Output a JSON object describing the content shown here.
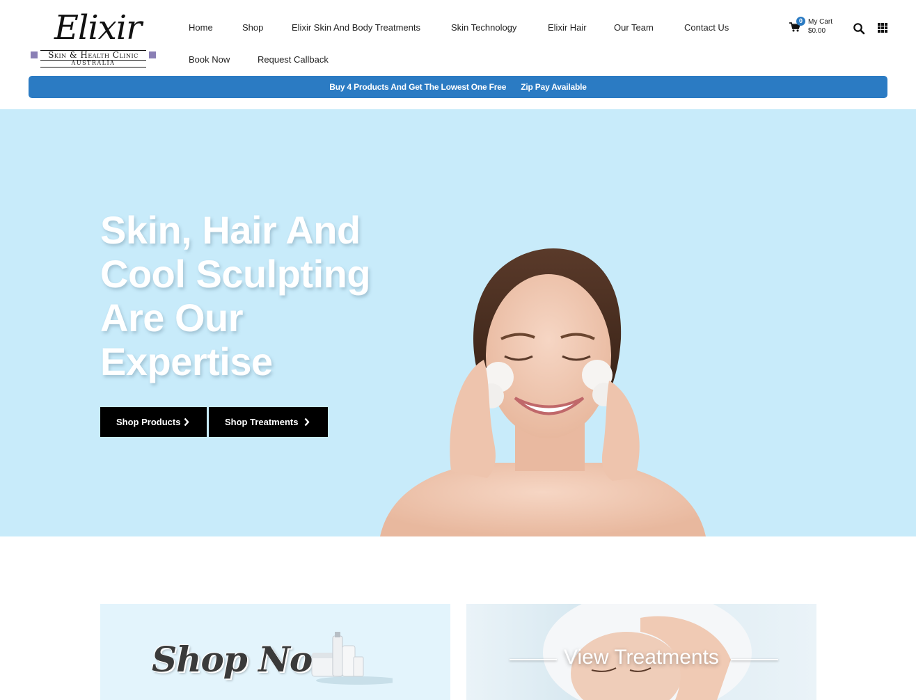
{
  "brand": {
    "logo_script": "Elixir",
    "logo_line1": "Skin & Health Clinic",
    "logo_line2": "AUSTRALIA"
  },
  "nav": {
    "items": [
      {
        "label": "Home"
      },
      {
        "label": "Shop"
      },
      {
        "label": "Elixir Skin And Body Treatments"
      },
      {
        "label": "Skin Technology"
      },
      {
        "label": "Elixir Hair"
      },
      {
        "label": "Our Team"
      },
      {
        "label": "Contact Us"
      },
      {
        "label": "Book Now"
      },
      {
        "label": "Request Callback"
      }
    ]
  },
  "cart": {
    "count": "0",
    "label": "My Cart",
    "total": "$0.00",
    "icon": "cart-icon"
  },
  "header_icons": {
    "search": "search-icon",
    "menu": "grid-menu-icon"
  },
  "promo_bar": {
    "offer": "Buy 4 Products And Get The Lowest One Free",
    "payment": "Zip Pay Available",
    "color": "#2b7bc3"
  },
  "hero": {
    "heading": "Skin, Hair And Cool Sculpting Are Our Expertise",
    "background": "#c8ebfa",
    "buttons": {
      "products": "Shop Products",
      "treatments": "Shop Treatments"
    }
  },
  "cards": {
    "shop": "Shop Now",
    "treatments": "View Treatments"
  }
}
